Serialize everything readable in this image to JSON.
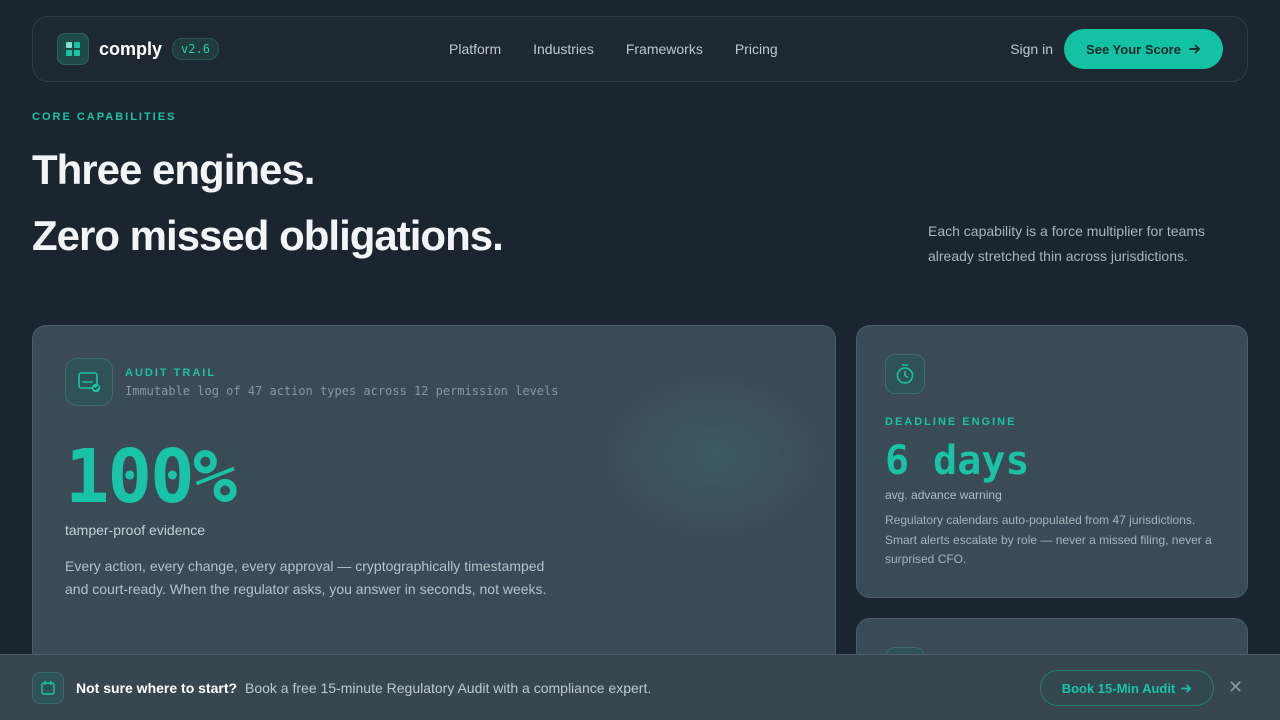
{
  "nav": {
    "brand": "comply",
    "version": "v2.6",
    "links": [
      "Platform",
      "Industries",
      "Frameworks",
      "Pricing"
    ],
    "signin": "Sign in",
    "cta": "See Your Score"
  },
  "hero": {
    "eyebrow": "CORE CAPABILITIES",
    "title_line1": "Three engines.",
    "title_line2": "Zero missed obligations.",
    "subcopy": "Each capability is a force multiplier for teams already stretched thin across jurisdictions."
  },
  "audit": {
    "kicker": "AUDIT TRAIL",
    "meta": "Immutable log of 47 action types across 12 permission levels",
    "stat": "100%",
    "caption": "tamper-proof evidence",
    "body": "Every action, every change, every approval — cryptographically timestamped and court-ready. When the regulator asks, you answer in seconds, not weeks."
  },
  "deadline": {
    "kicker": "DEADLINE ENGINE",
    "stat": "6 days",
    "caption": "avg. advance warning",
    "body": "Regulatory calendars auto-populated from 47 jurisdictions. Smart alerts escalate by role — never a missed filing, never a surprised CFO."
  },
  "banner": {
    "strong": "Not sure where to start?",
    "text": "Book a free 15-minute Regulatory Audit with a compliance expert.",
    "button": "Book 15-Min Audit",
    "close": "✕"
  },
  "colors": {
    "accent": "#19c3a6",
    "background": "#1b252f",
    "card": "#3a4a56"
  },
  "icons": {
    "logo": "grid-logo-icon",
    "audit": "document-check-icon",
    "deadline": "stopwatch-icon",
    "banner": "calendar-icon",
    "arrow": "arrow-right-icon",
    "close": "close-icon"
  }
}
